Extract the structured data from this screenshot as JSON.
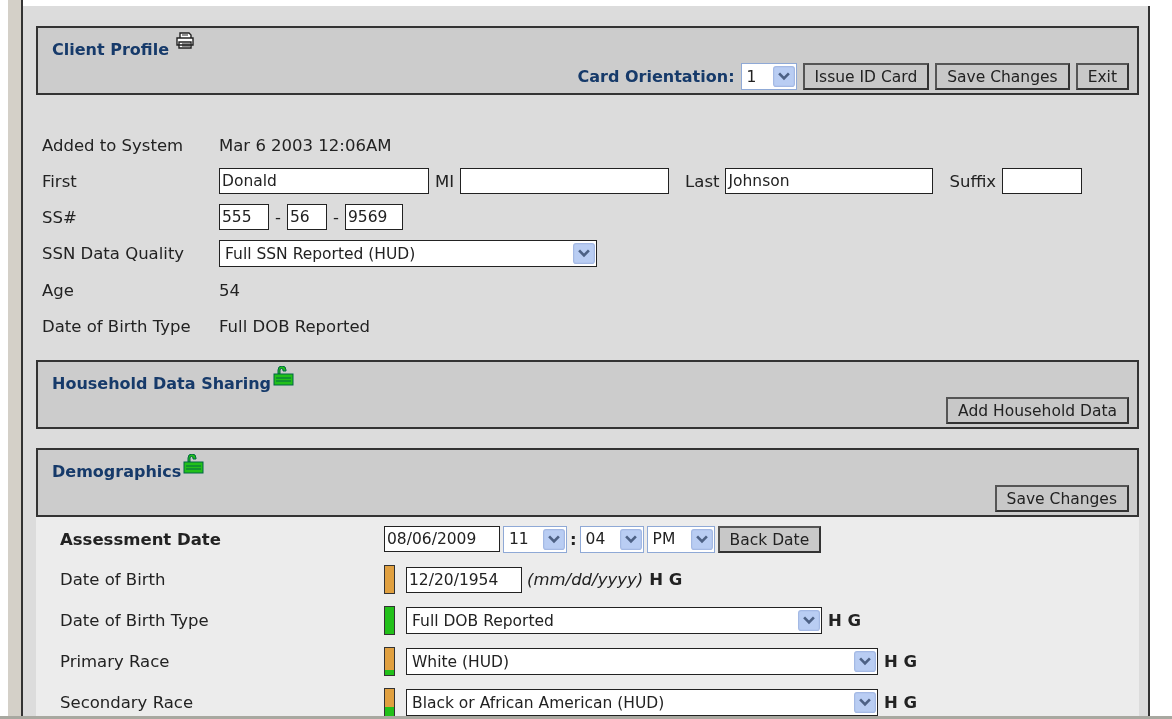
{
  "client_profile": {
    "title": "Client Profile",
    "card_orientation": {
      "label": "Card Orientation:",
      "value": "1"
    },
    "buttons": [
      "Issue ID Card",
      "Save Changes",
      "Exit"
    ]
  },
  "added_to_system": {
    "label": "Added to System",
    "value": "Mar 6 2003 12:06AM"
  },
  "name": {
    "first": {
      "label": "First",
      "value": "Donald"
    },
    "mi": {
      "label": "MI"
    },
    "last": {
      "label": "Last",
      "value": "Johnson"
    },
    "suffix": {
      "label": "Suffix"
    }
  },
  "ssn": {
    "label": "SS#",
    "parts": [
      "555",
      "56",
      "9569"
    ],
    "separators": [
      "-",
      "-"
    ]
  },
  "ssn_data_quality": {
    "label": "SSN Data Quality",
    "value": "Full SSN Reported (HUD)"
  },
  "age": {
    "label": "Age",
    "value": "54"
  },
  "dob_type": {
    "label": "Date of Birth Type",
    "value": "Full DOB Reported"
  },
  "household": {
    "title": "Household Data Sharing",
    "button": "Add Household Data"
  },
  "demographics": {
    "title": "Demographics",
    "button": "Save Changes",
    "assessment_date": {
      "label": "Assessment Date",
      "date": "08/06/2009",
      "hour": "11",
      "separator": ":",
      "minute": "04",
      "ampm": "PM",
      "button": "Back Date"
    },
    "rows": [
      {
        "kind": "date",
        "label": "Date of Birth",
        "value": "12/20/1954",
        "hint": "(mm/dd/yyyy)",
        "flags": "H G"
      },
      {
        "kind": "select",
        "label": "Date of Birth Type",
        "level": 1,
        "value": "Full DOB Reported",
        "flags": "H G"
      },
      {
        "kind": "wide-select",
        "label": "Primary Race",
        "level": 0.2,
        "value": "White (HUD)",
        "flags": "H G"
      },
      {
        "kind": "wide-select",
        "label": "Secondary Race",
        "level": 0.35,
        "value": "Black or African American (HUD)",
        "flags": "H G"
      }
    ]
  }
}
